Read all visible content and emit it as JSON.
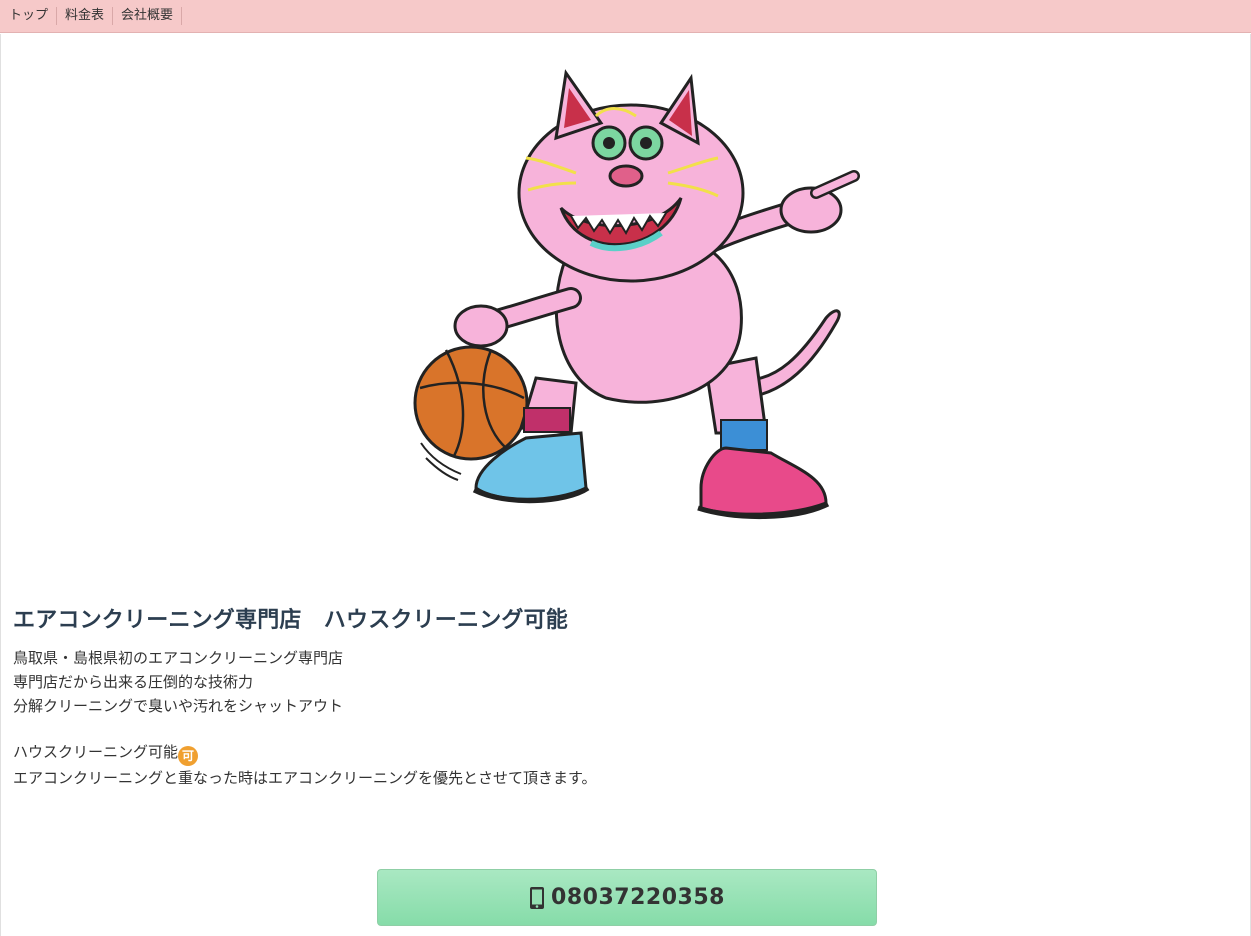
{
  "nav": {
    "items": [
      {
        "label": "トップ"
      },
      {
        "label": "料金表"
      },
      {
        "label": "会社概要"
      }
    ]
  },
  "hero": {
    "mascot": "pink-cat-basketball-illustration"
  },
  "main": {
    "headline": "エアコンクリーニング専門店　ハウスクリーニング可能",
    "lines": [
      "鳥取県・島根県初のエアコンクリーニング専門店",
      "専門店だから出来る圧倒的な技術力",
      "分解クリーニングで臭いや汚れをシャットアウト"
    ],
    "house_line": "ハウスクリーニング可能",
    "badge": "可",
    "note": "エアコンクリーニングと重なった時はエアコンクリーニングを優先とさせて頂きます。"
  },
  "call": {
    "icon": "mobile-phone-icon",
    "phone": "08037220358"
  },
  "colors": {
    "nav_bg": "#f6c9c9",
    "button_bg": "#95e0b3",
    "headline": "#2c3e50",
    "badge": "#f0a030"
  }
}
